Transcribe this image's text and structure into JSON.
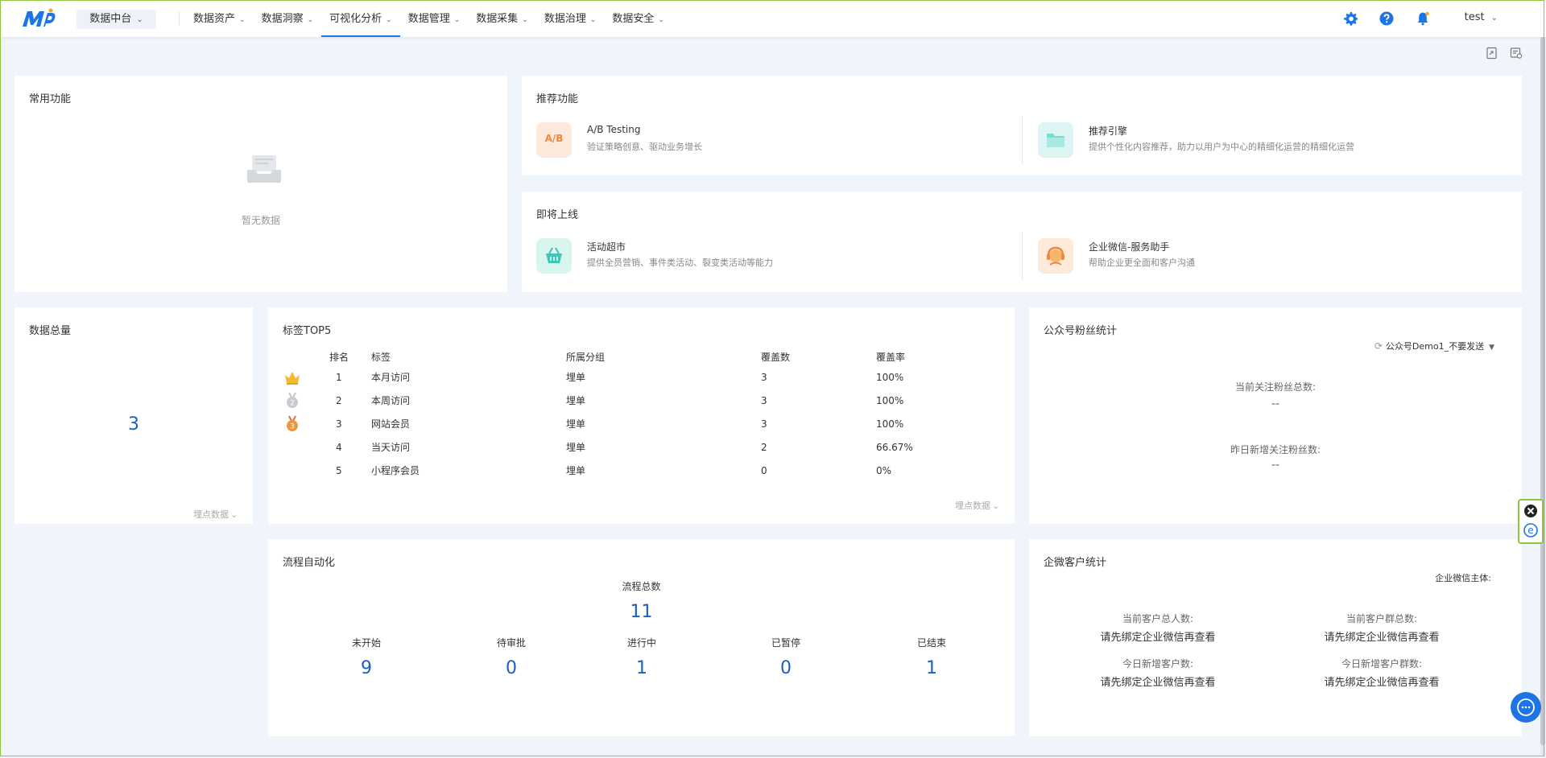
{
  "nav": {
    "platform_label": "数据中台",
    "items": [
      {
        "label": "数据资产"
      },
      {
        "label": "数据洞察"
      },
      {
        "label": "可视化分析"
      },
      {
        "label": "数据管理"
      },
      {
        "label": "数据采集"
      },
      {
        "label": "数据治理"
      },
      {
        "label": "数据安全"
      }
    ],
    "active_index": 2,
    "user": "test"
  },
  "common_functions": {
    "title": "常用功能",
    "empty_text": "暂无数据"
  },
  "recommended": {
    "title": "推荐功能",
    "items": [
      {
        "icon": "ab-testing-icon",
        "icon_text": "A/B",
        "title": "A/B Testing",
        "desc": "验证策略创意、驱动业务增长"
      },
      {
        "icon": "recommend-engine-icon",
        "title": "推荐引擎",
        "desc": "提供个性化内容推荐，助力以用户为中心的精细化运营的精细化运营"
      }
    ]
  },
  "coming_soon": {
    "title": "即将上线",
    "items": [
      {
        "icon": "activity-market-icon",
        "title": "活动超市",
        "desc": "提供全员营销、事件类活动、裂变类活动等能力"
      },
      {
        "icon": "wecom-assistant-icon",
        "title": "企业微信-服务助手",
        "desc": "帮助企业更全面和客户沟通"
      }
    ]
  },
  "data_total": {
    "title": "数据总量",
    "value": "3",
    "more": "埋点数据"
  },
  "tag_top5": {
    "title": "标签TOP5",
    "headers": [
      "排名",
      "标签",
      "所属分组",
      "覆盖数",
      "覆盖率"
    ],
    "rows": [
      {
        "rank": "1",
        "tag": "本月访问",
        "group": "埋单",
        "count": "3",
        "rate": "100%",
        "medal": "crown-icon"
      },
      {
        "rank": "2",
        "tag": "本周访问",
        "group": "埋单",
        "count": "3",
        "rate": "100%",
        "medal": "silver-medal-icon"
      },
      {
        "rank": "3",
        "tag": "网站会员",
        "group": "埋单",
        "count": "3",
        "rate": "100%",
        "medal": "bronze-medal-icon"
      },
      {
        "rank": "4",
        "tag": "当天访问",
        "group": "埋单",
        "count": "2",
        "rate": "66.67%",
        "medal": ""
      },
      {
        "rank": "5",
        "tag": "小程序会员",
        "group": "埋单",
        "count": "0",
        "rate": "0%",
        "medal": ""
      }
    ],
    "more": "埋点数据"
  },
  "wechat_fans": {
    "title": "公众号粉丝统计",
    "account": "公众号Demo1_不要发送",
    "current_label": "当前关注粉丝总数:",
    "current_value": "--",
    "new_label": "昨日新增关注粉丝数:",
    "new_value": "--"
  },
  "workflow": {
    "title": "流程自动化",
    "total_label": "流程总数",
    "total_value": "11",
    "stats": [
      {
        "label": "未开始",
        "value": "9"
      },
      {
        "label": "待审批",
        "value": "0"
      },
      {
        "label": "进行中",
        "value": "1"
      },
      {
        "label": "已暂停",
        "value": "0"
      },
      {
        "label": "已结束",
        "value": "1"
      }
    ]
  },
  "wecom_customers": {
    "title": "企微客户统计",
    "subject_label": "企业微信主体:",
    "stats": [
      {
        "label": "当前客户总人数:",
        "value": "请先绑定企业微信再查看"
      },
      {
        "label": "当前客户群总数:",
        "value": "请先绑定企业微信再查看"
      },
      {
        "label": "今日新增客户数:",
        "value": "请先绑定企业微信再查看"
      },
      {
        "label": "今日新增客户群数:",
        "value": "请先绑定企业微信再查看"
      }
    ]
  },
  "colors": {
    "accent": "#1d74e4",
    "number": "#1d5fbf",
    "border": "#8dc63f"
  }
}
